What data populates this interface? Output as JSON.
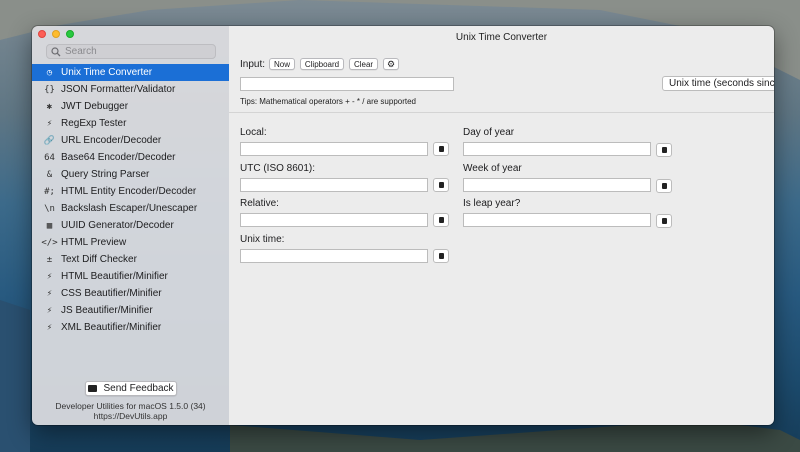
{
  "window": {
    "title": "Unix Time Converter"
  },
  "sidebar": {
    "search_placeholder": "Search",
    "items": [
      {
        "label": "Unix Time Converter",
        "icon": "clock-icon",
        "glyph": "◷",
        "active": true
      },
      {
        "label": "JSON Formatter/Validator",
        "icon": "braces-icon",
        "glyph": "{}"
      },
      {
        "label": "JWT Debugger",
        "icon": "jwt-icon",
        "glyph": "✱"
      },
      {
        "label": "RegExp Tester",
        "icon": "wand-icon",
        "glyph": "⚡"
      },
      {
        "label": "URL Encoder/Decoder",
        "icon": "link-icon",
        "glyph": "🔗"
      },
      {
        "label": "Base64 Encoder/Decoder",
        "icon": "base64-icon",
        "glyph": "64"
      },
      {
        "label": "Query String Parser",
        "icon": "ampersand-icon",
        "glyph": "&"
      },
      {
        "label": "HTML Entity Encoder/Decoder",
        "icon": "hash-icon",
        "glyph": "#;"
      },
      {
        "label": "Backslash Escaper/Unescaper",
        "icon": "backslash-icon",
        "glyph": "\\n"
      },
      {
        "label": "UUID Generator/Decoder",
        "icon": "uuid-icon",
        "glyph": "▦"
      },
      {
        "label": "HTML Preview",
        "icon": "code-icon",
        "glyph": "</>"
      },
      {
        "label": "Text Diff Checker",
        "icon": "diff-icon",
        "glyph": "±"
      },
      {
        "label": "HTML Beautifier/Minifier",
        "icon": "wand-icon",
        "glyph": "⚡"
      },
      {
        "label": "CSS Beautifier/Minifier",
        "icon": "wand-icon",
        "glyph": "⚡"
      },
      {
        "label": "JS Beautifier/Minifier",
        "icon": "wand-icon",
        "glyph": "⚡"
      },
      {
        "label": "XML Beautifier/Minifier",
        "icon": "wand-icon",
        "glyph": "⚡"
      }
    ],
    "feedback_label": "Send Feedback",
    "footer_line1": "Developer Utilities for macOS 1.5.0 (34)",
    "footer_line2": "https://DevUtils.app"
  },
  "input": {
    "label": "Input:",
    "now_label": "Now",
    "clipboard_label": "Clipboard",
    "clear_label": "Clear",
    "value": "",
    "format_selected": "Unix time (seconds since epoch)",
    "tips": "Tips: Mathematical operators + - * / are supported"
  },
  "outputs": {
    "local_label": "Local:",
    "utc_label": "UTC (ISO 8601):",
    "relative_label": "Relative:",
    "unix_label": "Unix time:",
    "day_of_year_label": "Day of year",
    "week_of_year_label": "Week of year",
    "leap_year_label": "Is leap year?"
  },
  "colors": {
    "accent": "#1b6fd6",
    "sidebar_bg": "#dedee2",
    "main_bg": "#ececec"
  }
}
